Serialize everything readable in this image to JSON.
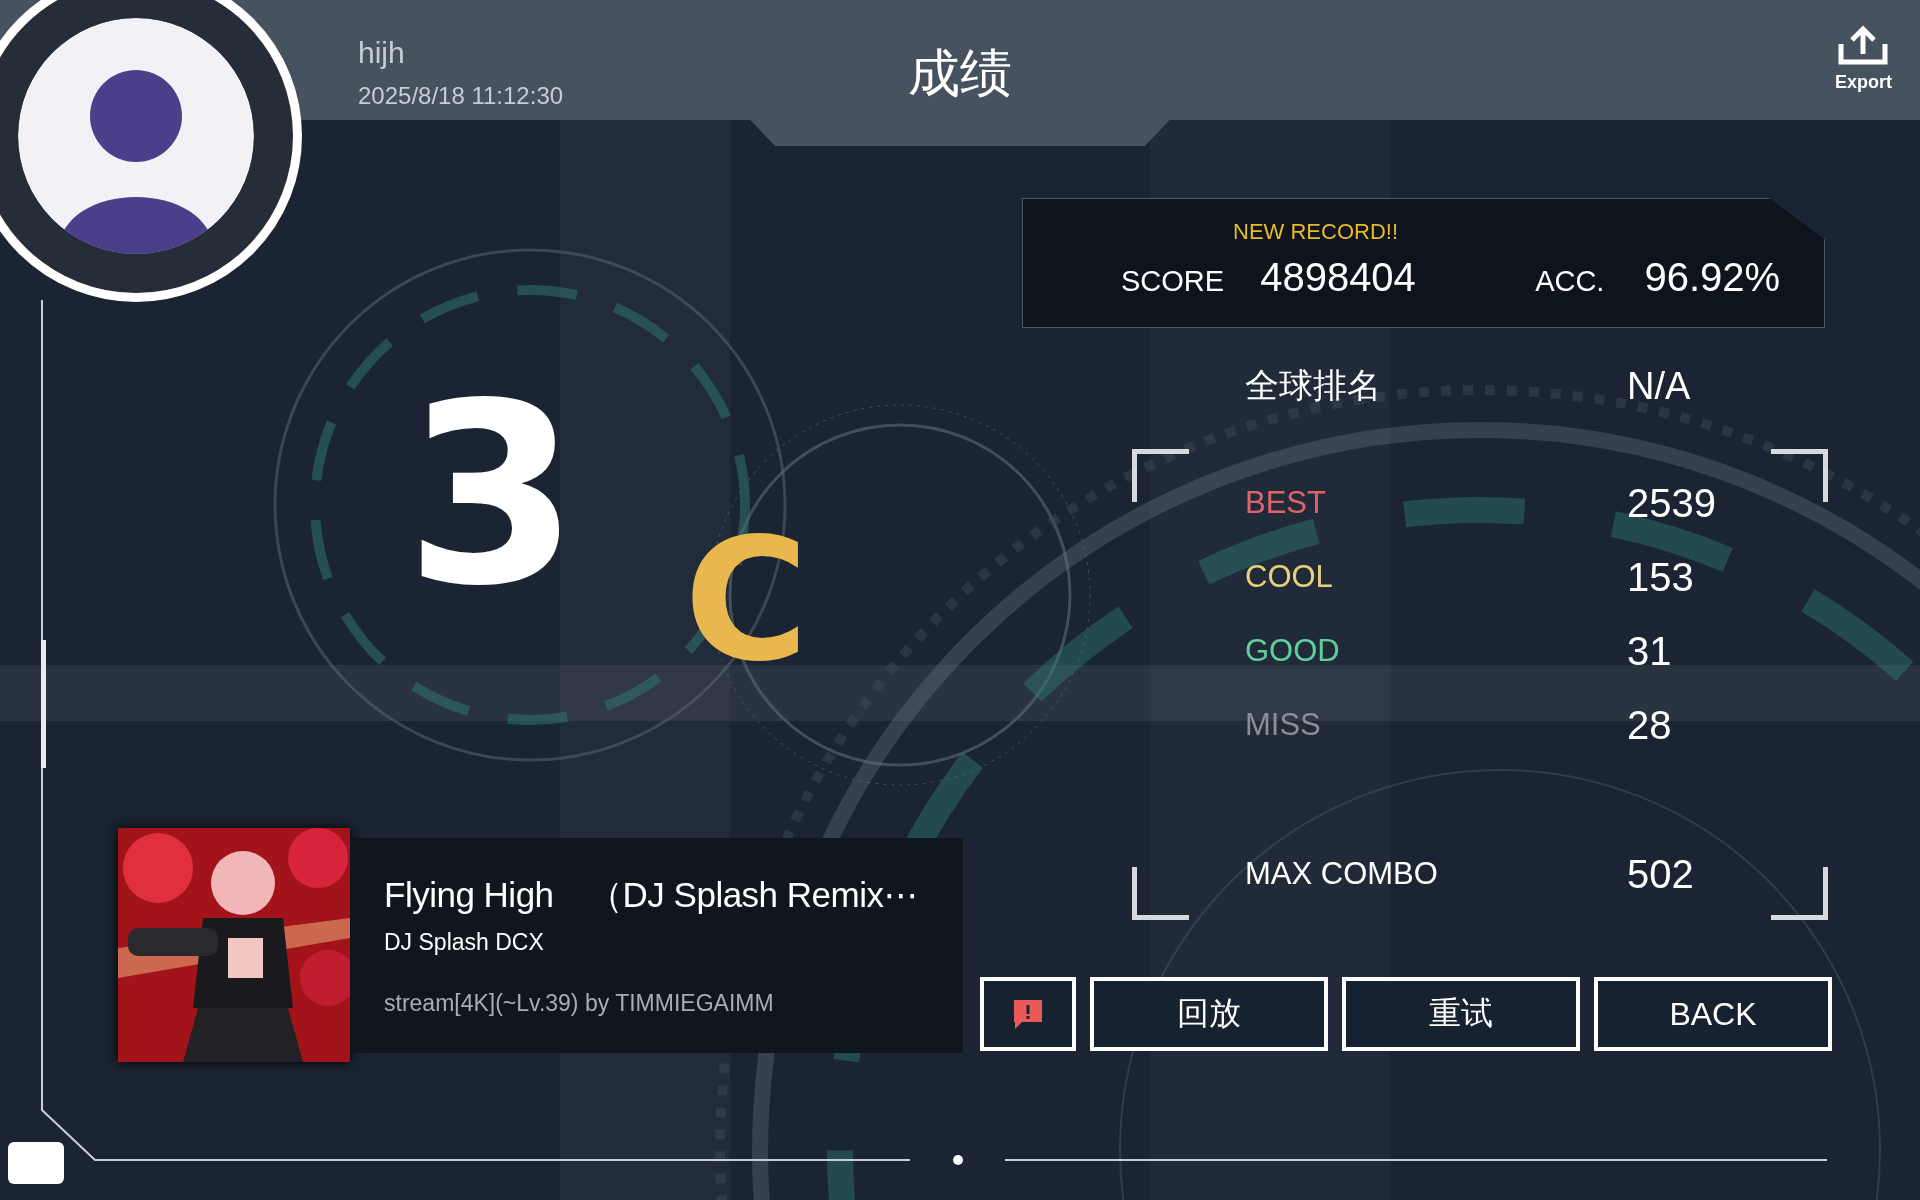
{
  "header": {
    "username": "hijh",
    "datetime": "2025/8/18 11:12:30",
    "title": "成绩",
    "export_label": "Export"
  },
  "rank": {
    "grade": "3",
    "sub_grade": "C"
  },
  "score_panel": {
    "badge": "NEW RECORD!!",
    "score_label": "SCORE",
    "score": "4898404",
    "acc_label": "ACC.",
    "acc": "96.92%"
  },
  "global_rank": {
    "label": "全球排名",
    "value": "N/A"
  },
  "judgements": [
    {
      "label": "BEST",
      "value": "2539",
      "color": "#e0636a"
    },
    {
      "label": "COOL",
      "value": "153",
      "color": "#e8cf7a"
    },
    {
      "label": "GOOD",
      "value": "31",
      "color": "#5fcf9a"
    },
    {
      "label": "MISS",
      "value": "28",
      "color": "#8a8f96"
    }
  ],
  "max_combo": {
    "label": "MAX COMBO",
    "value": "502"
  },
  "song": {
    "title": "Flying High　（DJ Splash Remix⋯",
    "artist": "DJ Splash DCX",
    "chart": "stream[4K](~Lv.39) by TIMMIEGAIMM"
  },
  "buttons": [
    {
      "kind": "report"
    },
    {
      "kind": "text",
      "label": "回放"
    },
    {
      "kind": "text",
      "label": "重试"
    },
    {
      "kind": "text",
      "label": "BACK"
    }
  ]
}
